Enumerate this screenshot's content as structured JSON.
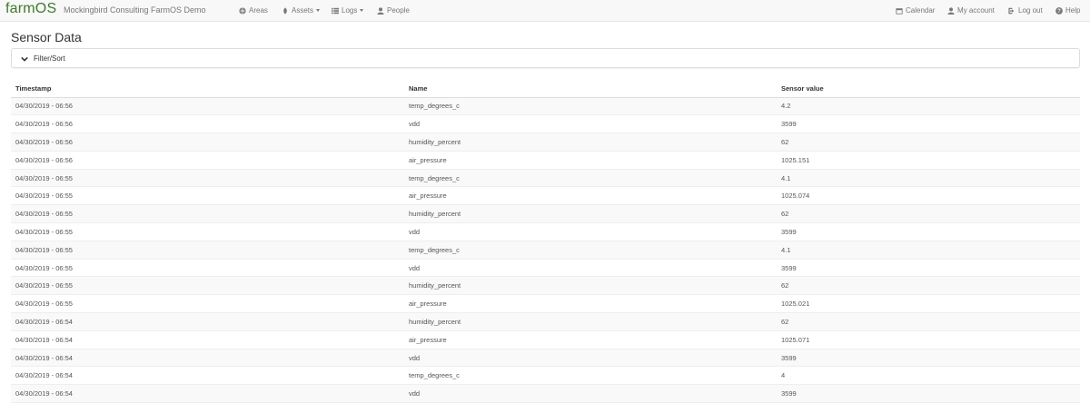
{
  "navbar": {
    "brand": "farmOS",
    "site_name": "Mockingbird Consulting FarmOS Demo",
    "left_items": [
      {
        "label": "Areas",
        "icon": "globe-icon"
      },
      {
        "label": "Assets",
        "icon": "leaf-icon",
        "dropdown": true
      },
      {
        "label": "Logs",
        "icon": "list-icon",
        "dropdown": true
      },
      {
        "label": "People",
        "icon": "user-icon"
      }
    ],
    "right_items": [
      {
        "label": "Calendar",
        "icon": "calendar-icon"
      },
      {
        "label": "My account",
        "icon": "user-icon"
      },
      {
        "label": "Log out",
        "icon": "logout-icon"
      },
      {
        "label": "Help",
        "icon": "question-icon"
      }
    ]
  },
  "page": {
    "title": "Sensor Data",
    "filter_label": "Filter/Sort"
  },
  "table": {
    "headers": [
      "Timestamp",
      "Name",
      "Sensor value"
    ],
    "rows": [
      [
        "04/30/2019 - 06:56",
        "temp_degrees_c",
        "4.2"
      ],
      [
        "04/30/2019 - 06:56",
        "vdd",
        "3599"
      ],
      [
        "04/30/2019 - 06:56",
        "humidity_percent",
        "62"
      ],
      [
        "04/30/2019 - 06:56",
        "air_pressure",
        "1025.151"
      ],
      [
        "04/30/2019 - 06:55",
        "temp_degrees_c",
        "4.1"
      ],
      [
        "04/30/2019 - 06:55",
        "air_pressure",
        "1025.074"
      ],
      [
        "04/30/2019 - 06:55",
        "humidity_percent",
        "62"
      ],
      [
        "04/30/2019 - 06:55",
        "vdd",
        "3599"
      ],
      [
        "04/30/2019 - 06:55",
        "temp_degrees_c",
        "4.1"
      ],
      [
        "04/30/2019 - 06:55",
        "vdd",
        "3599"
      ],
      [
        "04/30/2019 - 06:55",
        "humidity_percent",
        "62"
      ],
      [
        "04/30/2019 - 06:55",
        "air_pressure",
        "1025.021"
      ],
      [
        "04/30/2019 - 06:54",
        "humidity_percent",
        "62"
      ],
      [
        "04/30/2019 - 06:54",
        "air_pressure",
        "1025.071"
      ],
      [
        "04/30/2019 - 06:54",
        "vdd",
        "3599"
      ],
      [
        "04/30/2019 - 06:54",
        "temp_degrees_c",
        "4"
      ],
      [
        "04/30/2019 - 06:54",
        "vdd",
        "3599"
      ]
    ]
  }
}
